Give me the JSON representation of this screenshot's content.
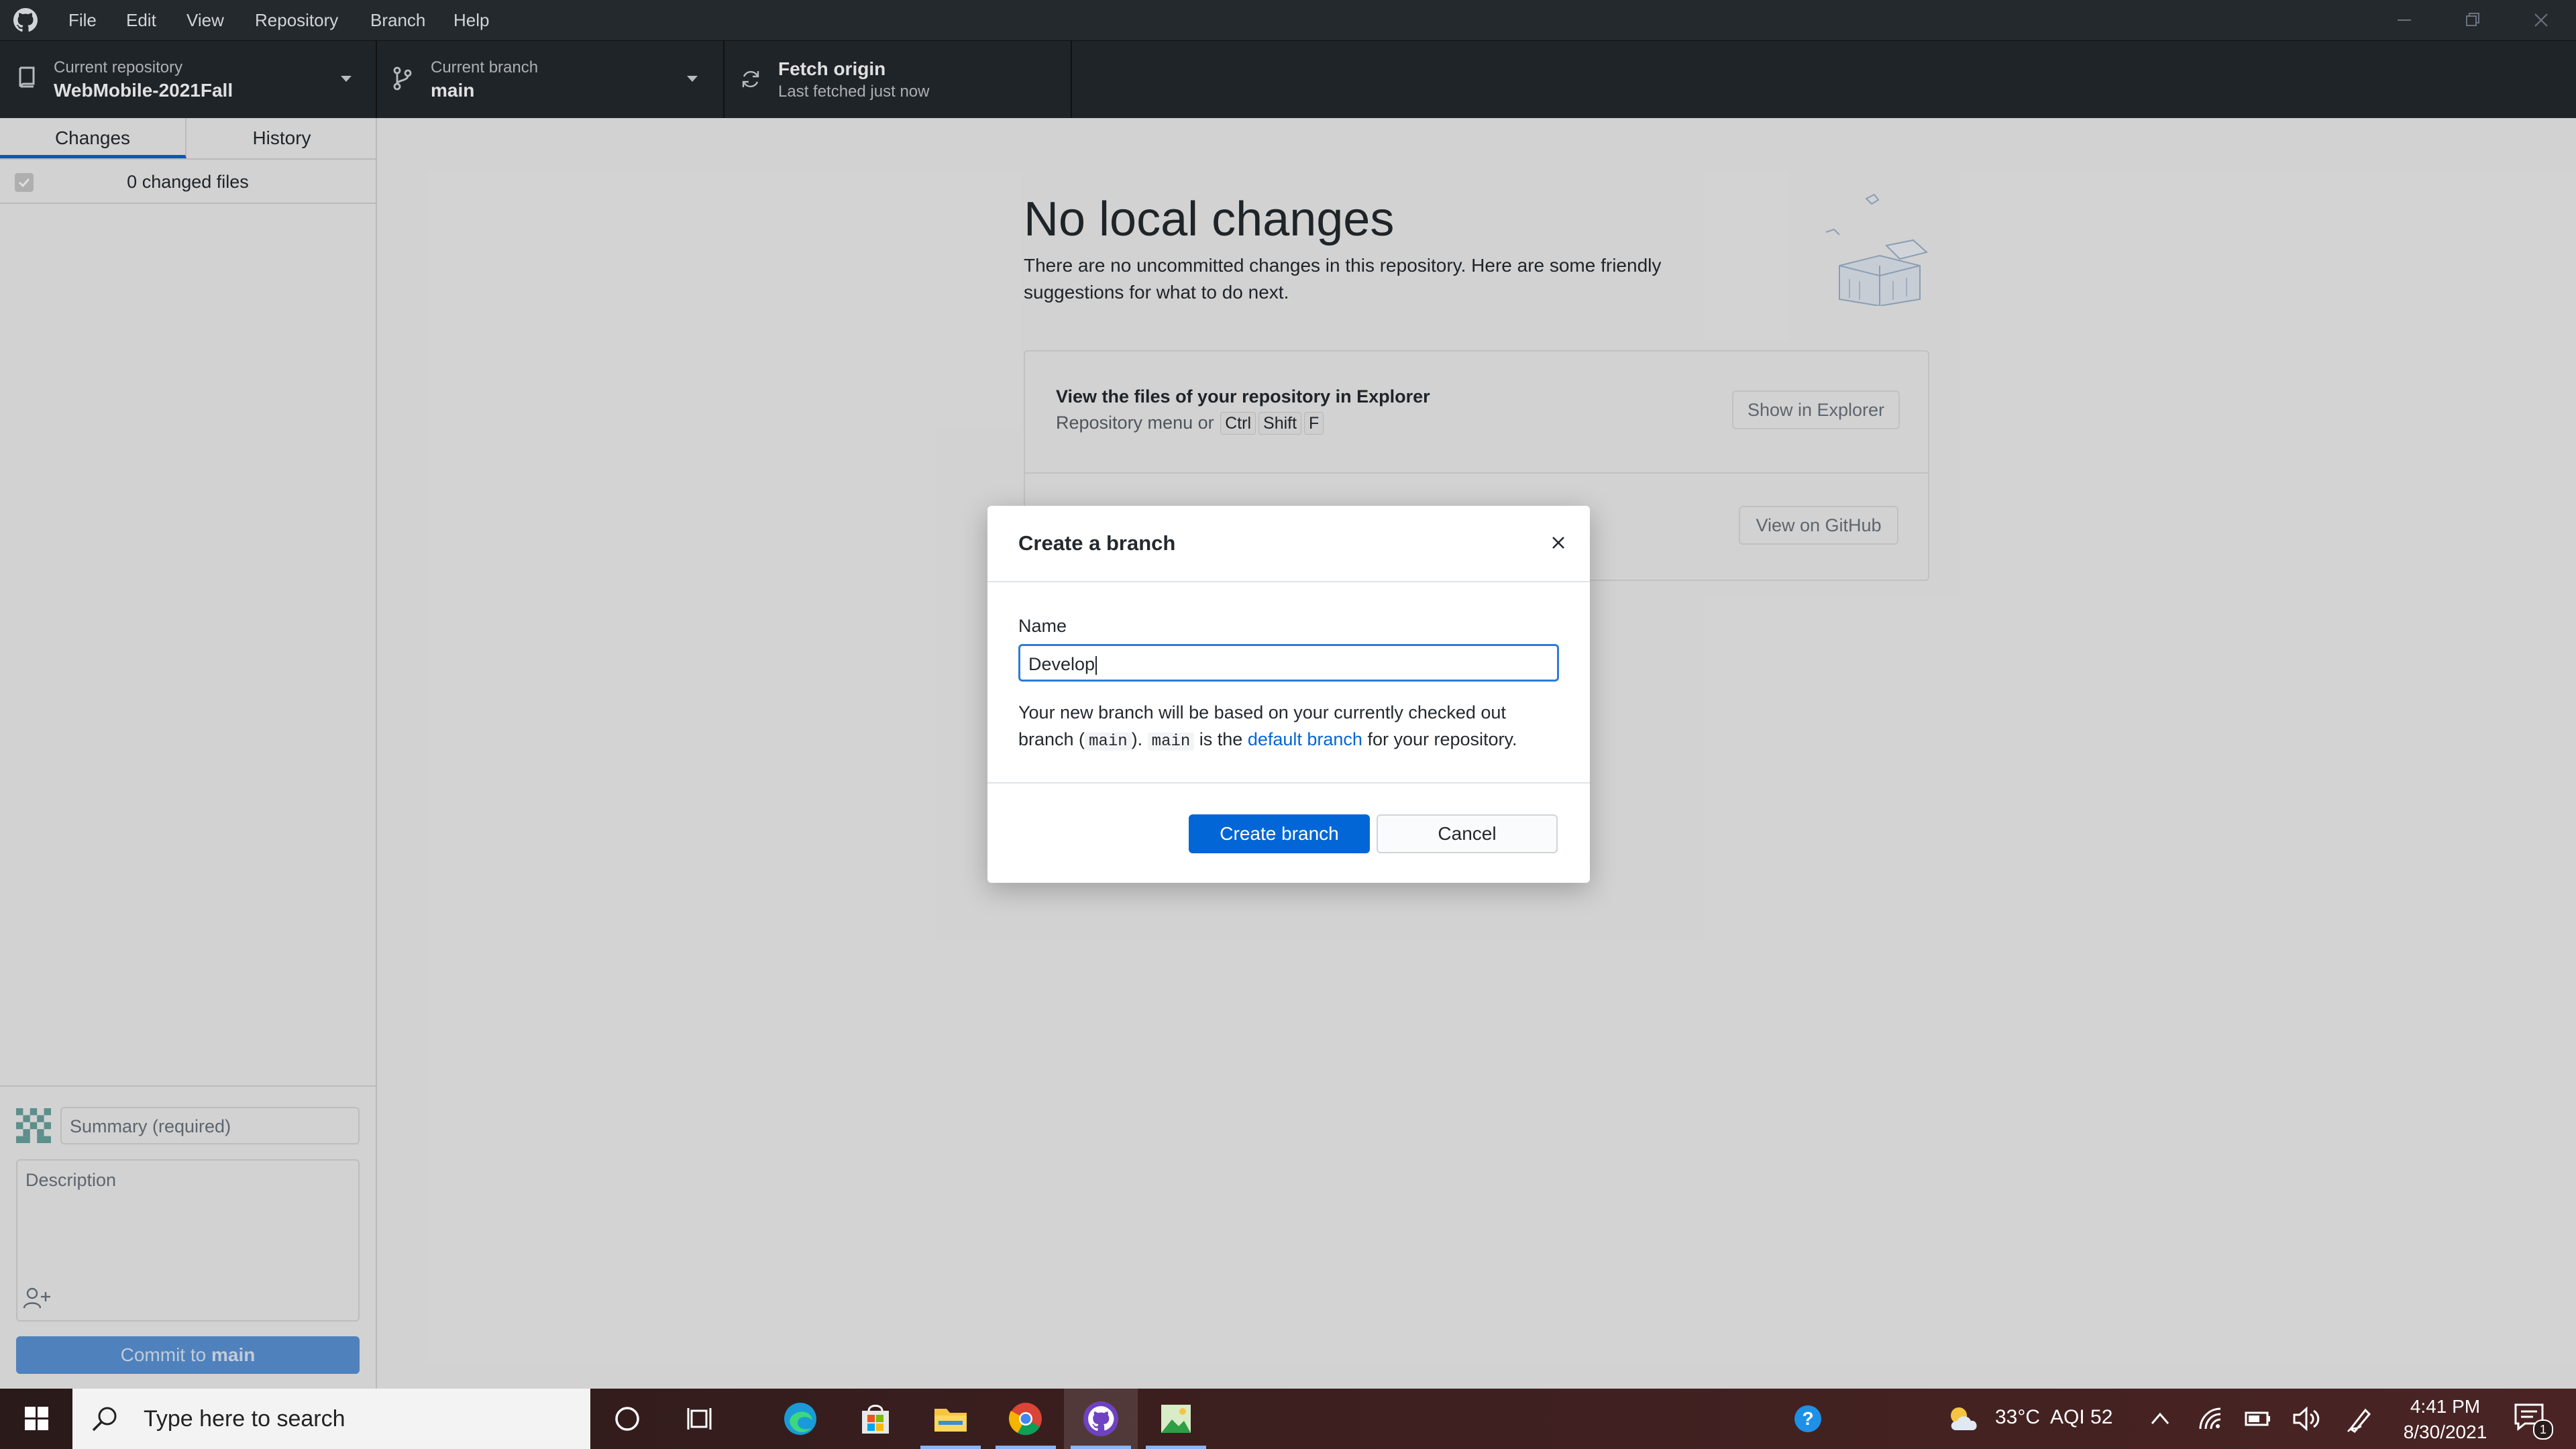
{
  "menubar": {
    "items": [
      "File",
      "Edit",
      "View",
      "Repository",
      "Branch",
      "Help"
    ]
  },
  "toolbar": {
    "repo_label": "Current repository",
    "repo_value": "WebMobile-2021Fall",
    "branch_label": "Current branch",
    "branch_value": "main",
    "fetch_label": "Fetch origin",
    "fetch_sub": "Last fetched just now"
  },
  "sidebar": {
    "tabs": [
      "Changes",
      "History"
    ],
    "changed_files": "0 changed files",
    "summary_placeholder": "Summary (required)",
    "description_placeholder": "Description",
    "commit_prefix": "Commit to ",
    "commit_branch": "main"
  },
  "main": {
    "title": "No local changes",
    "subtitle": "There are no uncommitted changes in this repository. Here are some friendly suggestions for what to do next.",
    "card1_title": "View the files of your repository in Explorer",
    "card1_hint": "Repository menu or",
    "card1_keys": [
      "Ctrl",
      "Shift",
      "F"
    ],
    "card1_button": "Show in Explorer",
    "card2_button": "View on GitHub"
  },
  "dialog": {
    "title": "Create a branch",
    "name_label": "Name",
    "name_value": "Develop",
    "info_1": "Your new branch will be based on your currently checked out branch (",
    "info_code1": "main",
    "info_2": "). ",
    "info_code2": "main",
    "info_3": " is the ",
    "info_link": "default branch",
    "info_4": " for your repository.",
    "create_button": "Create branch",
    "cancel_button": "Cancel"
  },
  "taskbar": {
    "search_placeholder": "Type here to search",
    "weather": "33°C  AQI 52",
    "time": "4:41 PM",
    "date": "8/30/2021",
    "notification_count": "1"
  },
  "colors": {
    "accent": "#0366d6",
    "titlebar": "#24292e",
    "commit_disabled": "#5a93d6"
  }
}
